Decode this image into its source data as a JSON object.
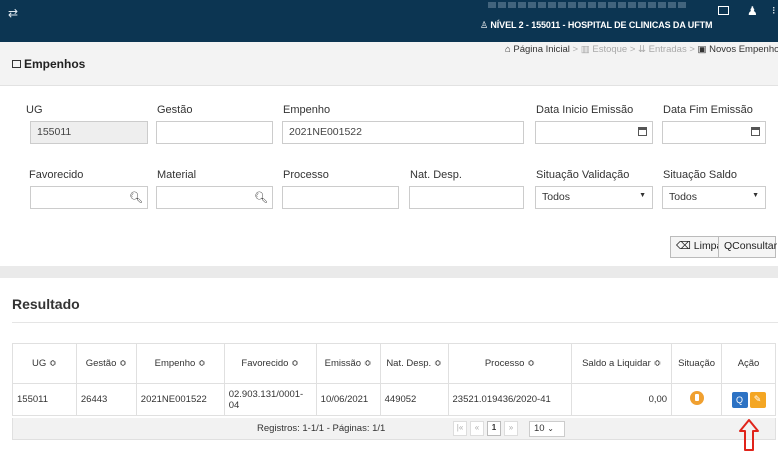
{
  "topbar": {
    "unit_label": "NÍVEL 2 - 155011 - HOSPITAL DE CLINICAS DA UFTM"
  },
  "header": {
    "title": "Empenhos",
    "breadcrumb": [
      "Página Inicial",
      "Estoque",
      "Entradas",
      "Novos Empenhos"
    ]
  },
  "filters": {
    "ug": {
      "label": "UG",
      "value": "155011"
    },
    "gestao": {
      "label": "Gestão",
      "value": ""
    },
    "empenho": {
      "label": "Empenho",
      "value": "2021NE001522"
    },
    "data_inicio": {
      "label": "Data Inicio Emissão",
      "value": ""
    },
    "data_fim": {
      "label": "Data Fim Emissão",
      "value": ""
    },
    "favorecido": {
      "label": "Favorecido",
      "value": ""
    },
    "material": {
      "label": "Material",
      "value": ""
    },
    "processo": {
      "label": "Processo",
      "value": ""
    },
    "nat_desp": {
      "label": "Nat. Desp.",
      "value": ""
    },
    "situacao_validacao": {
      "label": "Situação Validação",
      "value": "Todos"
    },
    "situacao_saldo": {
      "label": "Situação Saldo",
      "value": "Todos"
    },
    "limpar_label": "Limpar",
    "consultar_label": "Consultar"
  },
  "results": {
    "title": "Resultado",
    "columns": [
      "UG ≎",
      "Gestão ≎",
      "Empenho ≎",
      "Favorecido ≎",
      "Emissão ≎",
      "Nat. Desp. ≎",
      "Processo ≎",
      "Saldo a Liquidar ≎",
      "Situação",
      "Ação"
    ],
    "rows": [
      {
        "ug": "155011",
        "gestao": "26443",
        "empenho": "2021NE001522",
        "favorecido": "02.903.131/0001-04",
        "emissao": "10/06/2021",
        "nat_desp": "449052",
        "processo": "23521.019436/2020-41",
        "saldo": "0,00"
      }
    ],
    "records_label": "Registros: 1-1/1 - Páginas: 1/1",
    "current_page": "1",
    "page_size": "10"
  },
  "colors": {
    "topbar": "#0c3552",
    "view_button": "#2c72c4",
    "edit_button": "#f4a623",
    "status_icon": "#f0a030",
    "annotation_arrow": "#e0241b"
  }
}
